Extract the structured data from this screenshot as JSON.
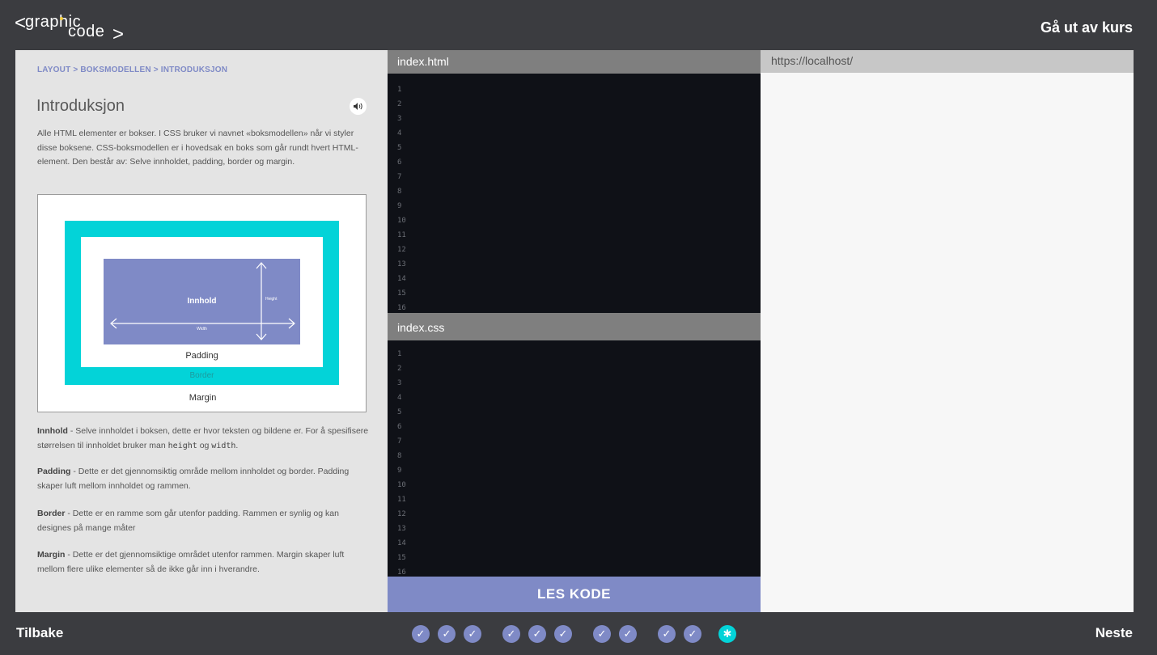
{
  "app": {
    "logo_lt": "<",
    "logo_graphic": "graphic",
    "logo_code": "code",
    "logo_gt": ">",
    "exit_label": "Gå ut av kurs"
  },
  "lesson": {
    "breadcrumb": "LAYOUT > BOKSMODELLEN > INTRODUKSJON",
    "title": "Introduksjon",
    "intro": "Alle HTML elementer er bokser. I CSS bruker vi navnet «boksmodellen» når vi styler disse boksene. CSS-boksmodellen er i hovedsak en boks som går rundt hvert HTML-element. Den består av: Selve innholdet, padding, border og margin.",
    "diagram": {
      "content": "Innhold",
      "height": "Height",
      "width": "Width",
      "padding": "Padding",
      "border": "Border",
      "margin": "Margin"
    },
    "definitions": {
      "content_term": "Innhold",
      "content_text_a": " - Selve innholdet i boksen, dette er hvor teksten og bildene er. For å spesifisere størrelsen til innholdet bruker man ",
      "content_code_height": "height",
      "content_text_b": " og ",
      "content_code_width": "width",
      "content_text_c": ".",
      "padding_term": "Padding",
      "padding_text": " - Dette er det gjennomsiktig område mellom innholdet og border. Padding skaper luft mellom innholdet og rammen.",
      "border_term": "Border",
      "border_text": " - Dette er en ramme som går utenfor padding. Rammen er synlig og kan designes på mange måter",
      "margin_term": "Margin",
      "margin_text": " - Dette er det gjennomsiktige området utenfor rammen. Margin skaper luft mellom flere ulike elementer så de ikke går inn i hverandre."
    }
  },
  "editors": {
    "html_filename": "index.html",
    "css_filename": "index.css",
    "html_lines": [
      "1",
      "2",
      "3",
      "4",
      "5",
      "6",
      "7",
      "8",
      "9",
      "10",
      "11",
      "12",
      "13",
      "14",
      "15",
      "16"
    ],
    "css_lines": [
      "1",
      "2",
      "3",
      "4",
      "5",
      "6",
      "7",
      "8",
      "9",
      "10",
      "11",
      "12",
      "13",
      "14",
      "15",
      "16"
    ],
    "run_label": "LES KODE"
  },
  "preview": {
    "url": "https://localhost/"
  },
  "footer": {
    "back_label": "Tilbake",
    "next_label": "Neste",
    "steps": [
      {
        "state": "done",
        "icon": "check-icon",
        "glyph": "✓"
      },
      {
        "state": "done",
        "icon": "check-icon",
        "glyph": "✓"
      },
      {
        "state": "done",
        "icon": "check-icon",
        "glyph": "✓"
      },
      {
        "state": "done",
        "icon": "check-icon",
        "glyph": "✓"
      },
      {
        "state": "done",
        "icon": "check-icon",
        "glyph": "✓"
      },
      {
        "state": "done",
        "icon": "check-icon",
        "glyph": "✓"
      },
      {
        "state": "done",
        "icon": "check-icon",
        "glyph": "✓"
      },
      {
        "state": "done",
        "icon": "check-icon",
        "glyph": "✓"
      },
      {
        "state": "done",
        "icon": "check-icon",
        "glyph": "✓"
      },
      {
        "state": "done",
        "icon": "check-icon",
        "glyph": "✓"
      },
      {
        "state": "current",
        "icon": "puzzle-icon",
        "glyph": "✱"
      }
    ]
  },
  "colors": {
    "background": "#3b3c40",
    "accent_purple": "#7f8ac6",
    "accent_cyan": "#03d3d8",
    "editor_bg": "#0f1117",
    "logo_dot": "#f4d03f"
  }
}
